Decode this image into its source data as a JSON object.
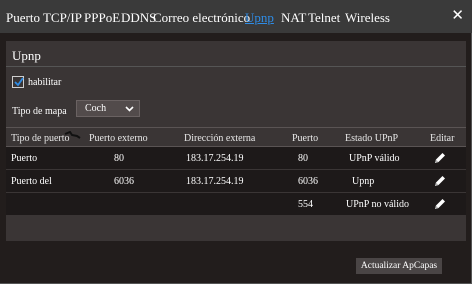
{
  "tabs": [
    {
      "label": "Puerto TCP/IP"
    },
    {
      "label": "PPPoE"
    },
    {
      "label": "DDNS"
    },
    {
      "label": "Correo electrónico"
    },
    {
      "label": "Upnp"
    },
    {
      "label": "NAT"
    },
    {
      "label": "Telnet"
    },
    {
      "label": "Wireless"
    }
  ],
  "close_symbol": "✕",
  "panel": {
    "title": "Upnp",
    "enable": {
      "label": "habilitar",
      "checked": true
    },
    "map_type": {
      "label": "Tipo de mapa",
      "value": "Coch"
    }
  },
  "table": {
    "headers": [
      "Tipo de puerto",
      "Puerto externo",
      "Dirección externa",
      "Puerto",
      "Estado UPnP",
      "Editar"
    ],
    "rows": [
      {
        "type": "Puerto",
        "ext_port": "80",
        "ext_addr": "183.17.254.19",
        "port": "80",
        "status": "UPnP válido"
      },
      {
        "type": "Puerto del",
        "ext_port": "6036",
        "ext_addr": "183.17.254.19",
        "port": "6036",
        "status": "Upnp"
      },
      {
        "type": "",
        "ext_port": "",
        "ext_addr": "",
        "port": "554",
        "status": "UPnP no válido"
      }
    ],
    "edit_icon": "pencil-icon"
  },
  "footer": {
    "refresh_label": "Actualizar ApCapas"
  },
  "colors": {
    "accent": "#2e8ce6",
    "background": "#221d1c",
    "panel": "#3a3535"
  }
}
